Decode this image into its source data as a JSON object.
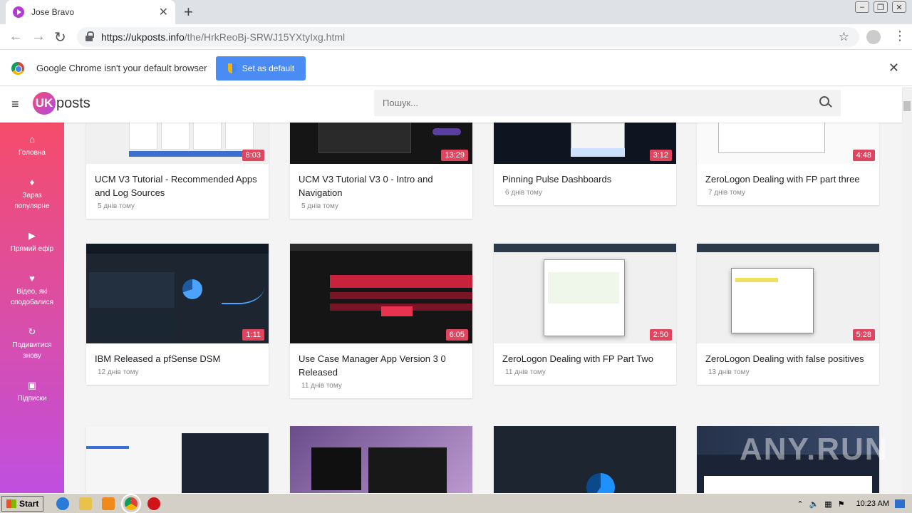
{
  "browser": {
    "tab_title": "Jose Bravo",
    "url_domain": "https://ukposts.info",
    "url_path": "/the/HrkReoBj-SRWJ15YXtyIxg.html",
    "infobar_text": "Google Chrome isn't your default browser",
    "set_default_label": "Set as default"
  },
  "site": {
    "logo_mark": "UK",
    "logo_text": "posts",
    "search_placeholder": "Пошук..."
  },
  "sidebar": [
    {
      "icon": "home-icon",
      "glyph": "⌂",
      "label": "Головна"
    },
    {
      "icon": "fire-icon",
      "glyph": "♦",
      "label": "Зараз популярне"
    },
    {
      "icon": "play-icon",
      "glyph": "▶",
      "label": "Прямий ефір"
    },
    {
      "icon": "heart-icon",
      "glyph": "♥",
      "label": "Відео, які сподобалися"
    },
    {
      "icon": "history-icon",
      "glyph": "↻",
      "label": "Подивитися знову"
    },
    {
      "icon": "subscriptions-icon",
      "glyph": "▣",
      "label": "Підписки"
    }
  ],
  "videos": [
    {
      "title": "UCM V3 Tutorial - Recommended Apps and Log Sources",
      "age": "5 днів тому",
      "duration": "8:03"
    },
    {
      "title": "UCM V3 Tutorial V3 0 - Intro and Navigation",
      "age": "5 днів тому",
      "duration": "13:29"
    },
    {
      "title": "Pinning Pulse Dashboards",
      "age": "6 днів тому",
      "duration": "3:12"
    },
    {
      "title": "ZeroLogon Dealing with FP part three",
      "age": "7 днів тому",
      "duration": "4:48"
    },
    {
      "title": "IBM Released a pfSense DSM",
      "age": "12 днів тому",
      "duration": "1:11"
    },
    {
      "title": "Use Case Manager App Version 3 0 Released",
      "age": "11 днів тому",
      "duration": "6:05"
    },
    {
      "title": "ZeroLogon Dealing with FP Part Two",
      "age": "11 днів тому",
      "duration": "2:50"
    },
    {
      "title": "ZeroLogon Dealing with false positives",
      "age": "13 днів тому",
      "duration": "5:28"
    }
  ],
  "taskbar": {
    "start_label": "Start",
    "clock": "10:23 AM"
  },
  "watermark": "ANY.RUN"
}
